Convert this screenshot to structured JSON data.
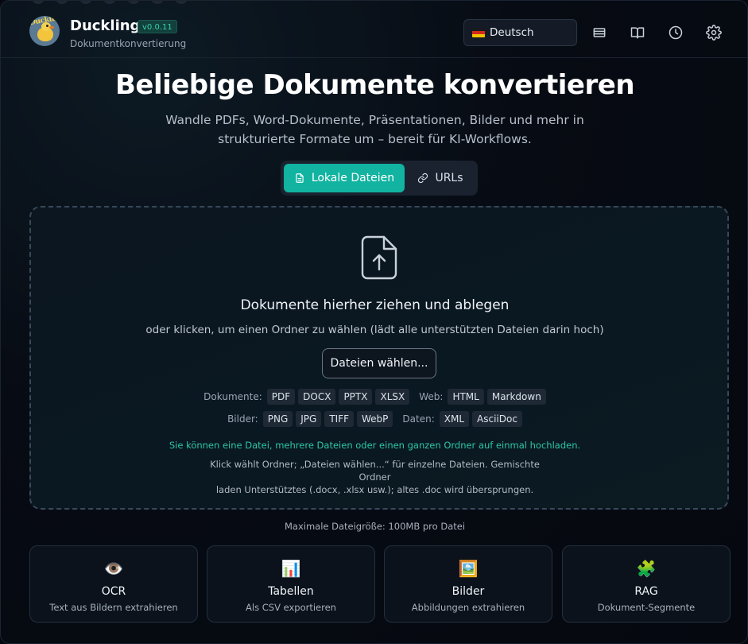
{
  "app": {
    "name": "Duckling",
    "version": "v0.0.11",
    "subtitle": "Dokumentkonvertierung",
    "logo_text": "Duckling"
  },
  "header": {
    "language": "Deutsch",
    "icons": [
      "list-icon",
      "book-icon",
      "history-icon",
      "settings-icon"
    ]
  },
  "hero": {
    "title": "Beliebige Dokumente konvertieren",
    "subtitle_line1": "Wandle PDFs, Word-Dokumente, Präsentationen, Bilder und mehr in",
    "subtitle_line2": "strukturierte Formate um – bereit für KI-Workflows."
  },
  "tabs": [
    {
      "label": "Lokale Dateien",
      "icon": "file-icon",
      "active": true
    },
    {
      "label": "URLs",
      "icon": "link-icon",
      "active": false
    }
  ],
  "dropzone": {
    "title": "Dokumente hierher ziehen und ablegen",
    "subtitle": "oder klicken, um einen Ordner zu wählen (lädt alle unterstützten Dateien darin hoch)",
    "button": "Dateien wählen...",
    "row1": {
      "documents_label": "Dokumente:",
      "documents": [
        "PDF",
        "DOCX",
        "PPTX",
        "XLSX"
      ],
      "web_label": "Web:",
      "web": [
        "HTML",
        "Markdown"
      ]
    },
    "row2": {
      "images_label": "Bilder:",
      "images": [
        "PNG",
        "JPG",
        "TIFF",
        "WebP"
      ],
      "data_label": "Daten:",
      "data": [
        "XML",
        "AsciiDoc"
      ]
    },
    "note_green": "Sie können eine Datei, mehrere Dateien oder einen ganzen Ordner auf einmal hochladen.",
    "note_line1": "Klick wählt Ordner; „Dateien wählen...“ für einzelne Dateien. Gemischte Ordner",
    "note_line2": "laden Unterstütztes (.docx, .xlsx usw.); altes .doc wird übersprungen."
  },
  "max_size": "Maximale Dateigröße: 100MB pro Datei",
  "features": [
    {
      "emoji": "👁️",
      "title": "OCR",
      "subtitle": "Text aus Bildern extrahieren"
    },
    {
      "emoji": "📊",
      "title": "Tabellen",
      "subtitle": "Als CSV exportieren"
    },
    {
      "emoji": "🖼️",
      "title": "Bilder",
      "subtitle": "Abbildungen extrahieren"
    },
    {
      "emoji": "🧩",
      "title": "RAG",
      "subtitle": "Dokument-Segmente"
    }
  ],
  "colors": {
    "accent": "#12b3a0",
    "accent_text": "#2dc7a6",
    "background": "#05080f"
  }
}
